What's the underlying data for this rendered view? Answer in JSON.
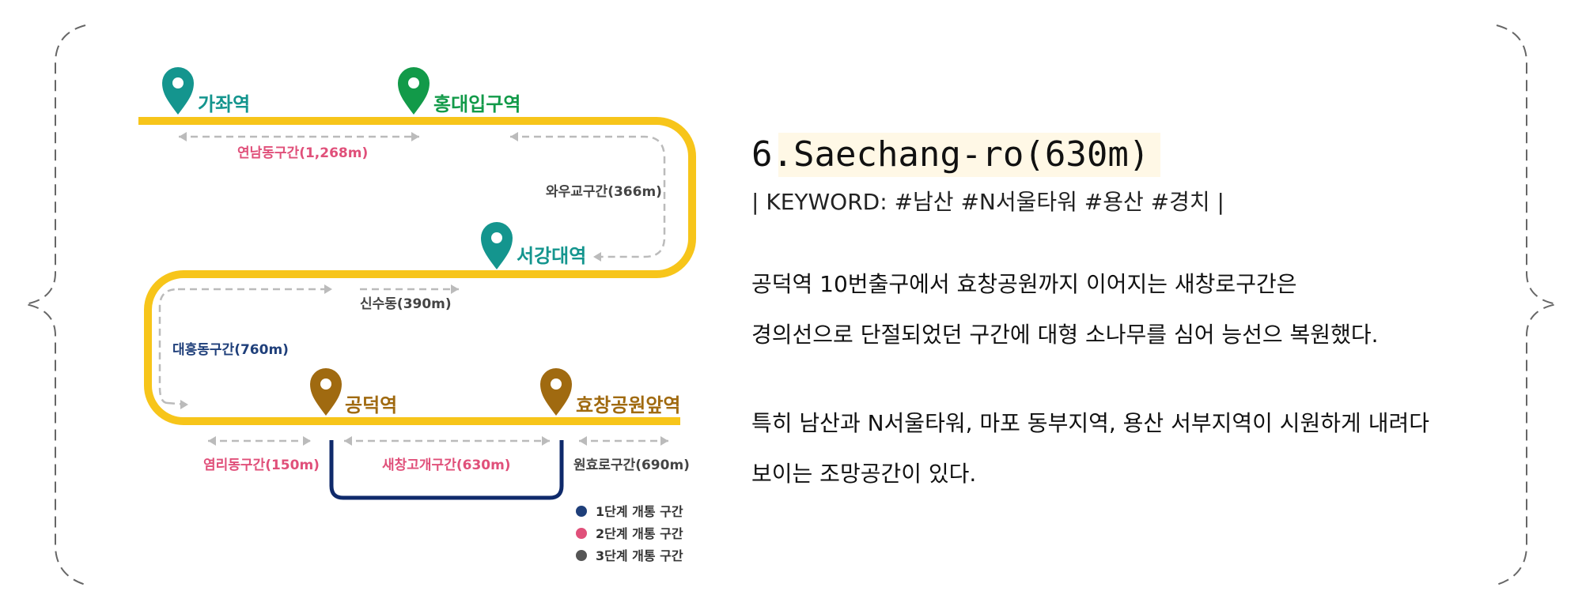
{
  "section": {
    "title": "6.Saechang-ro(630m)",
    "keyword_line": "| KEYWORD: #남산 #N서울타워 #용산 #경치 |",
    "paragraph1": [
      "공덕역 10번출구에서 효창공원까지 이어지는 새창로구간은",
      "경의선으로 단절되었던 구간에 대형 소나무를 심어 능선으 복원했다."
    ],
    "paragraph2": [
      "특히 남산과 N서울타워, 마포 동부지역, 용산 서부지역이 시원하게 내려다",
      "보이는 조망공간이 있다."
    ]
  },
  "map": {
    "stations": [
      {
        "name": "가좌역",
        "color": "#14958e"
      },
      {
        "name": "홍대입구역",
        "color": "#129a49"
      },
      {
        "name": "서강대역",
        "color": "#14958e"
      },
      {
        "name": "공덕역",
        "color": "#a06a10"
      },
      {
        "name": "효창공원앞역",
        "color": "#a06a10"
      }
    ],
    "segments": [
      {
        "name": "연남동구간(1,268m)",
        "color": "#e0507a"
      },
      {
        "name": "와우교구간(366m)",
        "color": "#444444"
      },
      {
        "name": "신수동(390m)",
        "color": "#444444"
      },
      {
        "name": "대흥동구간(760m)",
        "color": "#1f3f7a"
      },
      {
        "name": "염리동구간(150m)",
        "color": "#e0507a"
      },
      {
        "name": "새창고개구간(630m)",
        "color": "#e0507a"
      },
      {
        "name": "원효로구간(690m)",
        "color": "#444444"
      }
    ],
    "legend": [
      {
        "label": "1단계 개통 구간",
        "color": "#1f3f7a"
      },
      {
        "label": "2단계 개통 구간",
        "color": "#e0507a"
      },
      {
        "label": "3단계 개통 구간",
        "color": "#555555"
      }
    ],
    "route_color": "#f7c51a",
    "highlight_color": "#0f2a6b",
    "arrow_color": "#bbbbbb"
  }
}
